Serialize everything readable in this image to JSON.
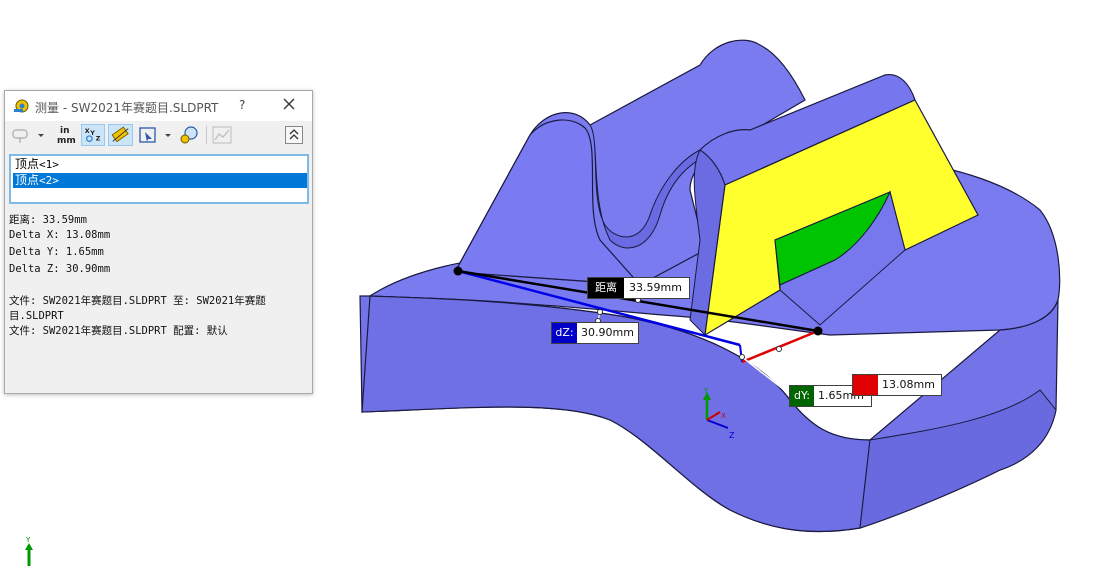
{
  "dialog": {
    "title": "测量 - SW2021年赛题目.SLDPRT",
    "help_label": "?",
    "toolbar": {
      "units_top": "in",
      "units_bottom": "mm"
    },
    "vertex_items": [
      {
        "label": "顶点",
        "suffix": "<1>"
      },
      {
        "label": "顶点",
        "suffix": "<2>"
      }
    ],
    "results": {
      "distance": "距离: 33.59mm",
      "delta_x": "Delta X: 13.08mm",
      "delta_y": "Delta Y: 1.65mm",
      "delta_z": "Delta Z: 30.90mm",
      "file_line_1": "文件: SW2021年赛题目.SLDPRT 至: SW2021年赛题",
      "file_line_1b": "目.SLDPRT",
      "file_line_2": "文件: SW2021年赛题目.SLDPRT 配置: 默认"
    }
  },
  "callouts": {
    "distance": {
      "label": "距离",
      "value": "33.59mm"
    },
    "dz": {
      "label": "dZ:",
      "value": "30.90mm"
    },
    "dy": {
      "label": "dY:",
      "value": "1.65mm"
    },
    "dx": {
      "label": "",
      "value": "13.08mm"
    }
  },
  "triad": {
    "x": "X",
    "y": "Y",
    "z": "Z"
  },
  "colors": {
    "part_body": "#7b7bf0",
    "part_edge": "#1a1a40",
    "selected_face": "#ffff2e",
    "inner_face": "#00c400",
    "dz_line": "#0000e6",
    "dx_line": "#e00000",
    "distance_line": "#000000",
    "dz_tag": "#0000c8",
    "dy_tag": "#006400",
    "dx_tag": "#e00000",
    "list_selection": "#0078d7"
  },
  "icons": [
    "measure-tape-icon",
    "close-icon",
    "arc-condition-icon",
    "units-icon",
    "xyz-delta-icon",
    "point-to-point-icon",
    "projection-icon",
    "sensor-icon",
    "history-icon",
    "collapse-icon"
  ]
}
